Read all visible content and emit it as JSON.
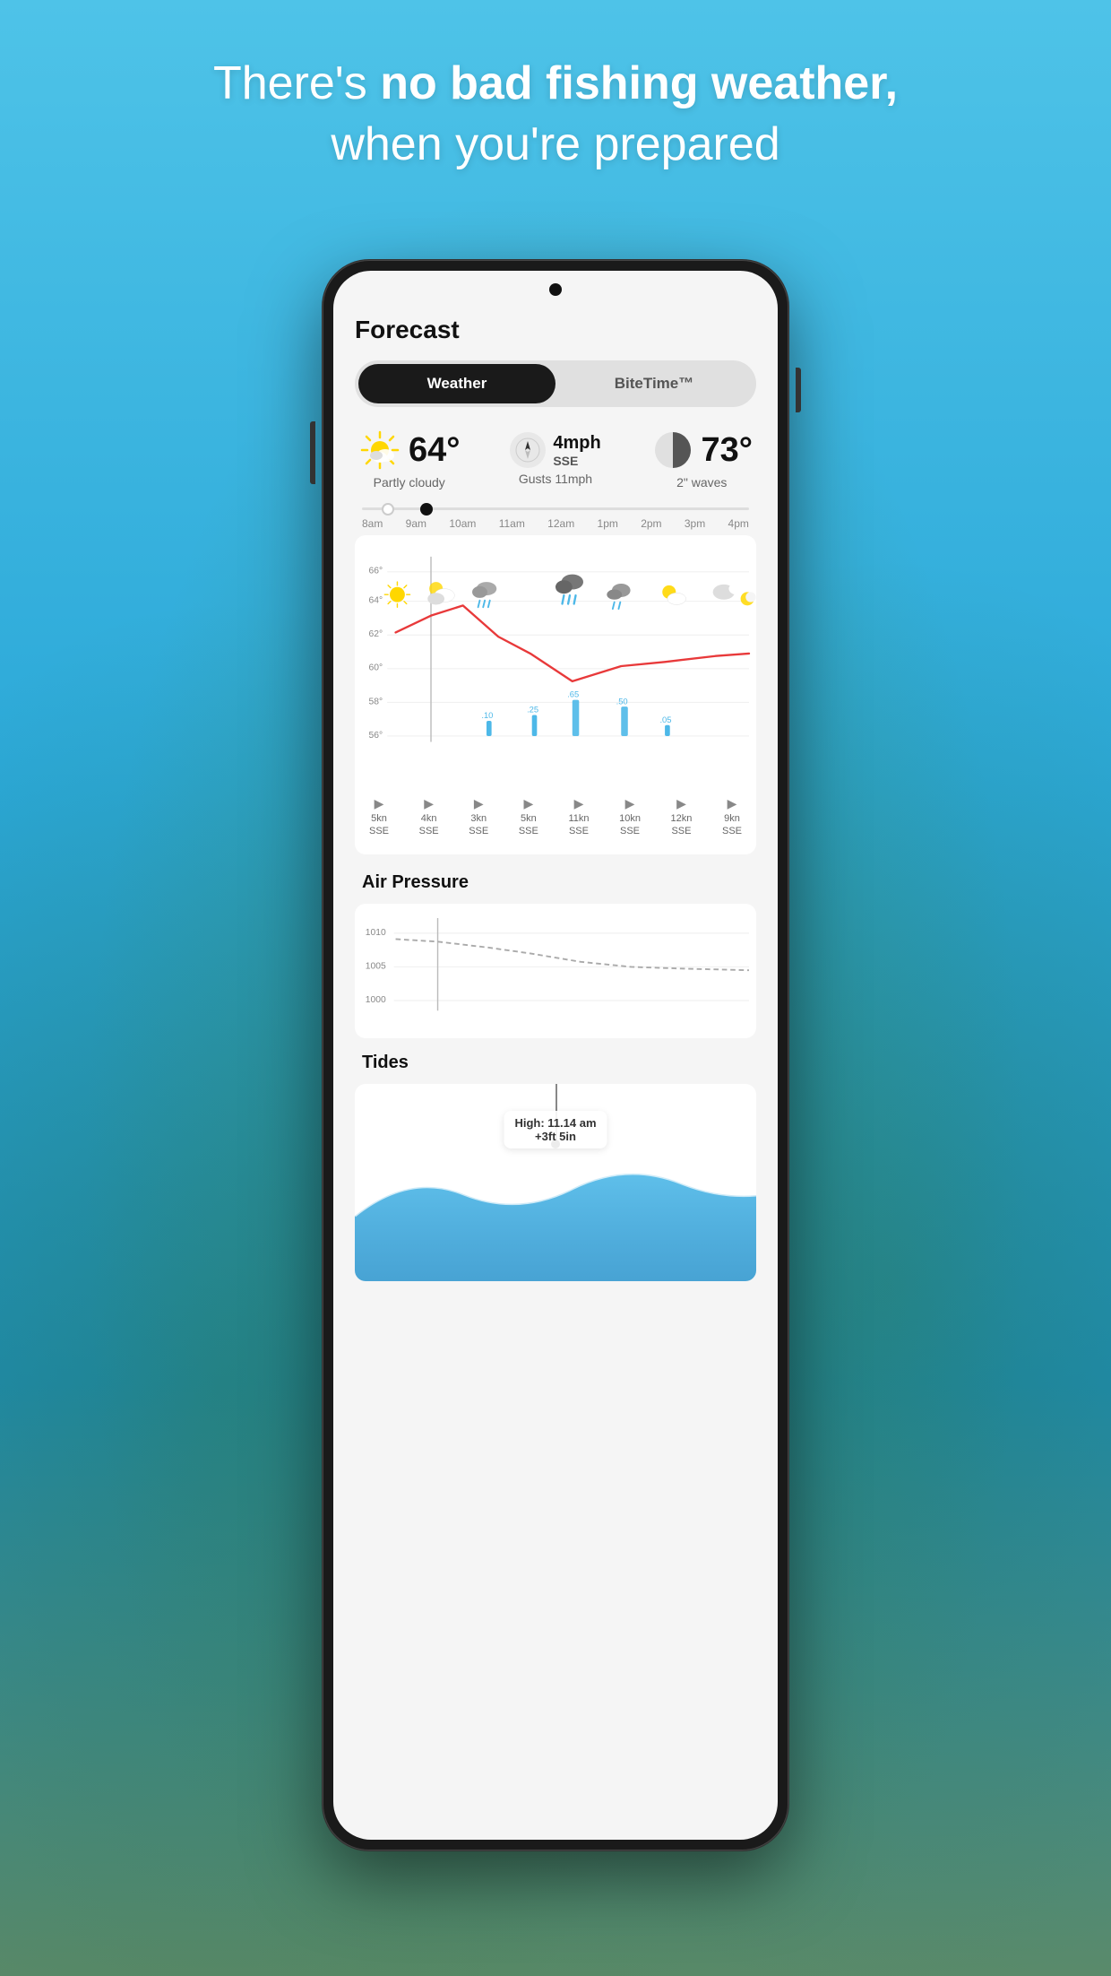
{
  "background": {
    "gradient_top": "#4ec3e8",
    "gradient_bottom": "#2ba8d8"
  },
  "headline": {
    "line1_normal": "There's ",
    "line1_bold": "no bad fishing weather,",
    "line2": "when you're prepared"
  },
  "phone": {
    "screen": {
      "forecast_title": "Forecast",
      "tabs": {
        "weather": "Weather",
        "bitetime": "BiteTime™",
        "active": "weather"
      },
      "weather_summary": {
        "temperature": "64°",
        "condition": "Partly cloudy",
        "wind_speed": "4mph",
        "wind_dir": "SSE",
        "wind_gusts": "Gusts 11mph",
        "waves_temp": "73°",
        "waves": "2\" waves"
      },
      "time_labels": [
        "8am",
        "9am",
        "10am",
        "11am",
        "12am",
        "1pm",
        "2pm",
        "3pm",
        "4pm"
      ],
      "temp_labels": [
        "66°",
        "64°",
        "62°",
        "60°",
        "58°",
        "56°"
      ],
      "rain_amounts": [
        ".10",
        ".25",
        ".65",
        ".50",
        ".05"
      ],
      "wind_cells": [
        {
          "speed": "5kn",
          "dir": "SSE"
        },
        {
          "speed": "4kn",
          "dir": "SSE"
        },
        {
          "speed": "3kn",
          "dir": "SSE"
        },
        {
          "speed": "5kn",
          "dir": "SSE"
        },
        {
          "speed": "11kn",
          "dir": "SSE"
        },
        {
          "speed": "10kn",
          "dir": "SSE"
        },
        {
          "speed": "12kn",
          "dir": "SSE"
        },
        {
          "speed": "9kn",
          "dir": "SSE"
        }
      ],
      "air_pressure": {
        "title": "Air Pressure",
        "levels": [
          "1010",
          "1005",
          "1000"
        ]
      },
      "tides": {
        "title": "Tides",
        "high_label": "High: 11.14 am",
        "high_value": "+3ft 5in"
      }
    }
  }
}
